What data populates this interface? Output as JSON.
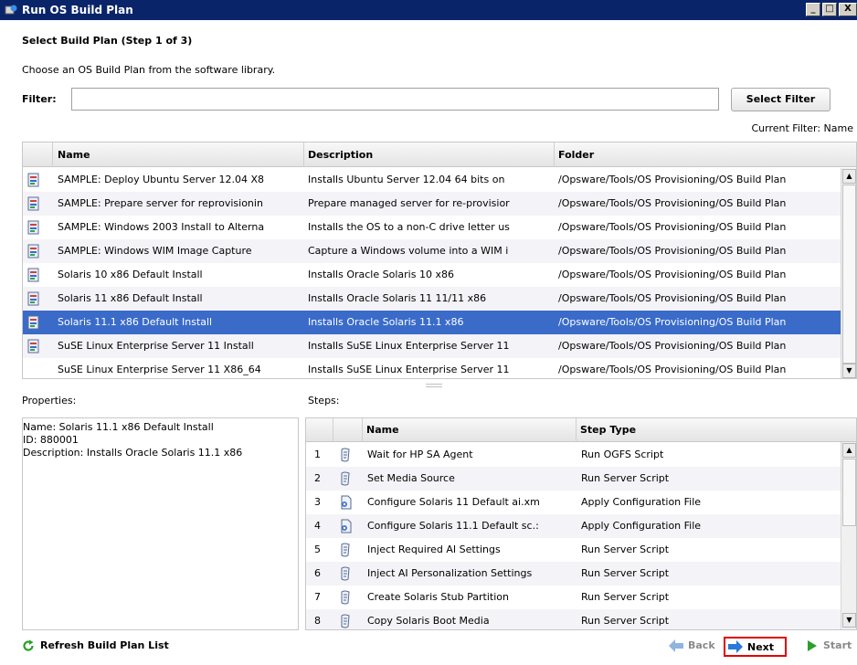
{
  "window": {
    "title": "Run OS Build Plan",
    "buttons": [
      "_",
      "□",
      "X"
    ]
  },
  "heading": "Select Build Plan (Step 1 of 3)",
  "subtitle": "Choose an OS Build Plan from the software library.",
  "filter": {
    "label": "Filter:",
    "value": "",
    "button": "Select Filter",
    "current": "Current Filter: Name"
  },
  "plans": {
    "columns": [
      "Name",
      "Description",
      "Folder"
    ],
    "rows": [
      {
        "icon": "build-plan-icon",
        "name": "SAMPLE: Deploy Ubuntu Server 12.04 X8",
        "description": "Installs Ubuntu Server 12.04 64 bits on",
        "folder": "/Opsware/Tools/OS Provisioning/OS Build Plan"
      },
      {
        "icon": "build-plan-icon",
        "name": "SAMPLE: Prepare server for reprovisionin",
        "description": "Prepare managed server for re-provisior",
        "folder": "/Opsware/Tools/OS Provisioning/OS Build Plan"
      },
      {
        "icon": "build-plan-icon",
        "name": "SAMPLE: Windows 2003 Install to Alterna",
        "description": "Installs the OS to a non-C drive letter us",
        "folder": "/Opsware/Tools/OS Provisioning/OS Build Plan"
      },
      {
        "icon": "build-plan-icon",
        "name": "SAMPLE: Windows WIM Image Capture",
        "description": "Capture a Windows volume into a WIM i",
        "folder": "/Opsware/Tools/OS Provisioning/OS Build Plan"
      },
      {
        "icon": "build-plan-icon",
        "name": "Solaris 10 x86 Default Install",
        "description": "Installs Oracle Solaris 10 x86",
        "folder": "/Opsware/Tools/OS Provisioning/OS Build Plan"
      },
      {
        "icon": "build-plan-icon",
        "name": "Solaris 11 x86 Default Install",
        "description": "Installs Oracle Solaris 11 11/11 x86",
        "folder": "/Opsware/Tools/OS Provisioning/OS Build Plan"
      },
      {
        "icon": "build-plan-icon",
        "name": "Solaris 11.1 x86 Default Install",
        "description": "Installs Oracle Solaris 11.1 x86",
        "folder": "/Opsware/Tools/OS Provisioning/OS Build Plan",
        "selected": true
      },
      {
        "icon": "build-plan-icon",
        "name": "SuSE Linux Enterprise Server 11 Install",
        "description": "Installs SuSE Linux Enterprise Server 11",
        "folder": "/Opsware/Tools/OS Provisioning/OS Build Plan"
      },
      {
        "icon": "",
        "name": "SuSE Linux Enterprise Server 11 X86_64",
        "description": "Installs SuSE Linux Enterprise Server 11",
        "folder": "/Opsware/Tools/OS Provisioning/OS Build Plan"
      }
    ]
  },
  "properties": {
    "label": "Properties:",
    "lines": [
      "Name: Solaris 11.1 x86 Default Install",
      "ID: 880001",
      "Description: Installs Oracle Solaris 11.1 x86"
    ]
  },
  "steps": {
    "label": "Steps:",
    "columns": [
      "Name",
      "Step Type"
    ],
    "rows": [
      {
        "num": "1",
        "icon": "script-icon",
        "name": "Wait for HP SA Agent",
        "type": "Run OGFS Script"
      },
      {
        "num": "2",
        "icon": "script-icon",
        "name": "Set Media Source",
        "type": "Run Server Script"
      },
      {
        "num": "3",
        "icon": "config-file-icon",
        "name": "Configure Solaris 11 Default ai.xm",
        "type": "Apply Configuration File"
      },
      {
        "num": "4",
        "icon": "config-file-icon",
        "name": "Configure Solaris 11.1 Default sc.:",
        "type": "Apply Configuration File"
      },
      {
        "num": "5",
        "icon": "script-icon",
        "name": "Inject Required AI Settings",
        "type": "Run Server Script"
      },
      {
        "num": "6",
        "icon": "script-icon",
        "name": "Inject AI Personalization Settings",
        "type": "Run Server Script"
      },
      {
        "num": "7",
        "icon": "script-icon",
        "name": "Create Solaris Stub Partition",
        "type": "Run Server Script"
      },
      {
        "num": "8",
        "icon": "script-icon",
        "name": "Copy Solaris Boot Media",
        "type": "Run Server Script"
      }
    ]
  },
  "footer": {
    "refresh": "Refresh Build Plan List",
    "back": "Back",
    "next": "Next",
    "start": "Start"
  },
  "colors": {
    "titlebar": "#0a246a",
    "selection": "#3a6bc9",
    "highlight_border": "#e00000",
    "start_green": "#2aa02a",
    "nav_blue": "#2a7ad8"
  }
}
